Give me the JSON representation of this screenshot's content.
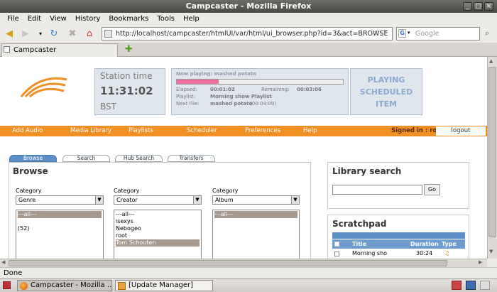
{
  "window": {
    "title": "Campcaster - Mozilla Firefox"
  },
  "menu": [
    "File",
    "Edit",
    "View",
    "History",
    "Bookmarks",
    "Tools",
    "Help"
  ],
  "nav": {
    "url": "http://localhost/campcaster/htmlUI/var/html/ui_browser.php?id=3&act=BROWSE",
    "search_placeholder": "Google"
  },
  "tab": {
    "label": "Campcaster"
  },
  "station": {
    "label": "Station time",
    "time": "11:31:02",
    "tz": "BST"
  },
  "now_playing": {
    "header": "Now playing: mashed potato",
    "elapsed_label": "Elapsed:",
    "elapsed": "00:01:02",
    "remaining_label": "Remaining:",
    "remaining": "00:03:06",
    "playlist_label": "Playlist:",
    "playlist": "Morning show Playlist",
    "next_label": "Next File:",
    "next": "mashed potato",
    "next_dur": "(00:04:09)",
    "progress": 0.25
  },
  "playing_box": {
    "line1": "PLAYING",
    "line2": "SCHEDULED",
    "line3": "ITEM"
  },
  "mainnav": {
    "items": [
      "Add Audio",
      "Media Library",
      "Playlists",
      "Scheduler",
      "Preferences",
      "Help"
    ],
    "signed_in": "Signed in : root",
    "logout": "logout"
  },
  "subtabs": [
    "Browse",
    "Search",
    "Hub Search",
    "Transfers"
  ],
  "browse": {
    "title": "Browse",
    "columns": [
      {
        "label": "Category",
        "selected": "Genre",
        "items": [
          "---all---",
          "",
          "(52)"
        ],
        "highlight": 0
      },
      {
        "label": "Category",
        "selected": "Creator",
        "items": [
          "---all---",
          "isexys",
          "Nebogeo",
          "root",
          "Tom Schouten"
        ],
        "highlight": 4
      },
      {
        "label": "Category",
        "selected": "Album",
        "items": [
          "---all---"
        ],
        "highlight": 0
      }
    ]
  },
  "library": {
    "title": "Library search",
    "go": "Go"
  },
  "scratchpad": {
    "title": "Scratchpad",
    "headers": [
      "Title",
      "Duration",
      "Type"
    ],
    "rows": [
      {
        "title": "Morning sho",
        "duration": "30:24"
      }
    ]
  },
  "status": {
    "text": "Done"
  },
  "taskbar": {
    "items": [
      "Campcaster - Mozilla ...",
      "[Update Manager]"
    ]
  }
}
